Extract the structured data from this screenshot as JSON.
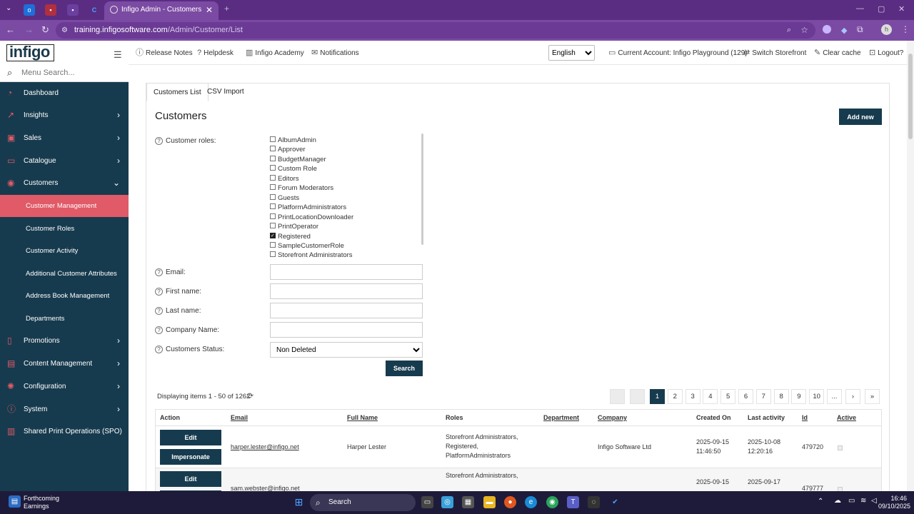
{
  "browser": {
    "tab_title": "Infigo Admin - Customers",
    "url_host": "training.infigosoftware.com",
    "url_path": "/Admin/Customer/List"
  },
  "sidebar": {
    "logo": "infigo",
    "search_placeholder": "Menu Search...",
    "items": [
      {
        "label": "Dashboard",
        "icon": "dashboard-icon",
        "glyph": "◔"
      },
      {
        "label": "Insights",
        "icon": "chart-line-icon",
        "glyph": "↗"
      },
      {
        "label": "Sales",
        "icon": "cart-icon",
        "glyph": "▣"
      },
      {
        "label": "Catalogue",
        "icon": "folder-icon",
        "glyph": "▭"
      },
      {
        "label": "Customers",
        "icon": "user-icon",
        "glyph": "◉"
      },
      {
        "label": "Promotions",
        "icon": "promotions-icon",
        "glyph": "▯"
      },
      {
        "label": "Content Management",
        "icon": "content-icon",
        "glyph": "▤"
      },
      {
        "label": "Configuration",
        "icon": "gear-icon",
        "glyph": "✺"
      },
      {
        "label": "System",
        "icon": "info-icon",
        "glyph": "ⓘ"
      },
      {
        "label": "Shared Print Operations (SPO)",
        "icon": "print-icon",
        "glyph": "▥"
      }
    ],
    "sub_items": [
      "Customer Management",
      "Customer Roles",
      "Customer Activity",
      "Additional Customer Attributes",
      "Address Book Management",
      "Departments"
    ]
  },
  "toolbar": {
    "release_notes": "Release Notes",
    "helpdesk": "Helpdesk",
    "academy": "Infigo Academy",
    "notifications": "Notifications",
    "language": "English",
    "current_account": "Current Account: Infigo Playground (129)",
    "switch_storefront": "Switch Storefront",
    "clear_cache": "Clear cache",
    "logout": "Logout?"
  },
  "tabs": [
    "Customers List",
    "CSV Import"
  ],
  "page_title": "Customers",
  "add_new": "Add new",
  "filters": {
    "roles_label": "Customer roles:",
    "roles": [
      {
        "name": "AlbumAdmin",
        "checked": false
      },
      {
        "name": "Approver",
        "checked": false
      },
      {
        "name": "BudgetManager",
        "checked": false
      },
      {
        "name": "Custom Role",
        "checked": false
      },
      {
        "name": "Editors",
        "checked": false
      },
      {
        "name": "Forum Moderators",
        "checked": false
      },
      {
        "name": "Guests",
        "checked": false
      },
      {
        "name": "PlatformAdministrators",
        "checked": false
      },
      {
        "name": "PrintLocationDownloader",
        "checked": false
      },
      {
        "name": "PrintOperator",
        "checked": false
      },
      {
        "name": "Registered",
        "checked": true
      },
      {
        "name": "SampleCustomerRole",
        "checked": false
      },
      {
        "name": "Storefront Administrators",
        "checked": false
      }
    ],
    "email_label": "Email:",
    "first_name_label": "First name:",
    "last_name_label": "Last name:",
    "company_label": "Company Name:",
    "status_label": "Customers Status:",
    "status_value": "Non Deleted",
    "search": "Search"
  },
  "grid": {
    "display_count": "Displaying items 1 - 50 of 1262",
    "pages": [
      "1",
      "2",
      "3",
      "4",
      "5",
      "6",
      "7",
      "8",
      "9",
      "10",
      "..."
    ],
    "current_page": "1",
    "headers": [
      "Action",
      "Email",
      "Full Name",
      "Roles",
      "Department",
      "Company",
      "Created On",
      "Last activity",
      "Id",
      "Active"
    ],
    "edit_label": "Edit",
    "impersonate_label": "Impersonate",
    "rows": [
      {
        "email": "harper.lester@infigo.net",
        "full_name": "Harper Lester",
        "roles_line1": "Storefront Administrators,",
        "roles_line2": "Registered,",
        "roles_line3": "PlatformAdministrators",
        "company": "Infigo Software Ltd",
        "created_date": "2025-09-15",
        "created_time": "11:46:50",
        "activity_date": "2025-10-08",
        "activity_time": "12:20:16",
        "id": "479720"
      },
      {
        "email": "sam.webster@infigo.net",
        "full_name": "",
        "roles_line1": "Storefront Administrators,",
        "roles_line2": "",
        "roles_line3": "",
        "company": "",
        "created_date": "2025-09-15",
        "created_time": "",
        "activity_date": "2025-09-17",
        "activity_time": "",
        "id": "479777"
      }
    ]
  },
  "taskbar": {
    "weather_title": "Forthcoming",
    "weather_sub": "Earnings",
    "search": "Search",
    "time": "16:46",
    "date": "09/10/2025"
  }
}
